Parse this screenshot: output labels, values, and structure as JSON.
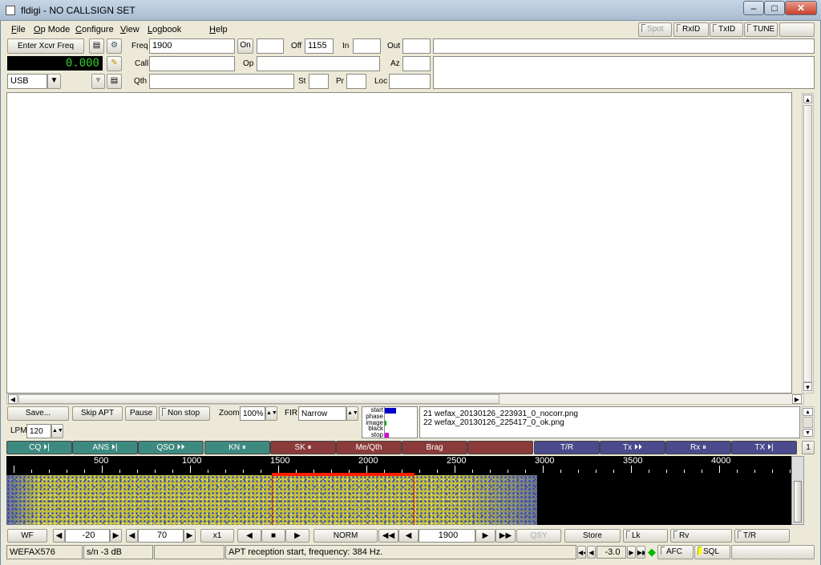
{
  "window": {
    "title": "fldigi - NO CALLSIGN SET",
    "min": "–",
    "max": "□",
    "close": "✕"
  },
  "menu": {
    "file": "File",
    "opmode": "Op Mode",
    "configure": "Configure",
    "view": "View",
    "logbook": "Logbook",
    "help": "Help"
  },
  "top_toggles": {
    "spot": "Spot",
    "rxid": "RxID",
    "txid": "TxID",
    "tune": "TUNE"
  },
  "rig": {
    "enter_freq": "Enter Xcvr Freq",
    "freq_display": "0.000",
    "mode": "USB"
  },
  "log": {
    "freq_label": "Freq",
    "freq_value": "1900",
    "on_label": "On",
    "off_label": "Off",
    "off_value": "1155",
    "in_label": "In",
    "out_label": "Out",
    "call_label": "Call",
    "op_label": "Op",
    "az_label": "Az",
    "qth_label": "Qth",
    "st_label": "St",
    "pr_label": "Pr",
    "loc_label": "Loc"
  },
  "wefax": {
    "save": "Save...",
    "skip_apt": "Skip APT",
    "pause": "Pause",
    "non_stop": "Non stop",
    "zoom_label": "Zoom",
    "zoom_value": "100%",
    "fir_label": "FIR",
    "fir_value": "Narrow",
    "lpm_label": "LPM",
    "lpm_value": "120",
    "phases": [
      "start",
      "phase",
      "image",
      "black",
      "stop"
    ],
    "files": [
      "21 wefax_20130126_223931_0_nocorr.png",
      "22 wefax_20130126_225417_0_ok.png"
    ]
  },
  "macros": [
    {
      "label": "CQ ⏵|",
      "color": "teal"
    },
    {
      "label": "ANS ⏵|",
      "color": "teal"
    },
    {
      "label": "QSO ⏵⏵",
      "color": "teal"
    },
    {
      "label": "KN ⏸",
      "color": "teal"
    },
    {
      "label": "SK ⏸",
      "color": "red"
    },
    {
      "label": "Me/Qth",
      "color": "red"
    },
    {
      "label": "Brag",
      "color": "red"
    },
    {
      "label": "",
      "color": "red"
    },
    {
      "label": "T/R",
      "color": "blue"
    },
    {
      "label": "Tx ⏵⏵",
      "color": "blue"
    },
    {
      "label": "Rx ⏸",
      "color": "blue"
    },
    {
      "label": "TX ⏵|",
      "color": "blue"
    }
  ],
  "macro_page": "1",
  "scale": {
    "labels": [
      "500",
      "1000",
      "1500",
      "2000",
      "2500",
      "3000",
      "3500",
      "4000"
    ]
  },
  "wf_controls": {
    "wf": "WF",
    "ref": "-20",
    "range": "70",
    "speed": "x1",
    "norm": "NORM",
    "carrier": "1900",
    "qsy": "QSY",
    "store": "Store",
    "lk": "Lk",
    "rv": "Rv",
    "tr": "T/R"
  },
  "status": {
    "mode": "WEFAX576",
    "sn": "s/n  -3 dB",
    "message": "APT reception start, frequency: 384 Hz.",
    "squelch": "-3.0",
    "afc": "AFC",
    "sql": "SQL"
  },
  "colors": {
    "teal": "#3d8a80",
    "red": "#8b3a3a",
    "blue": "#4a4a8c",
    "waterfall_yellow": "#c4be3a",
    "waterfall_blue": "#2b3fb8",
    "marker_red": "#ff1f00"
  }
}
